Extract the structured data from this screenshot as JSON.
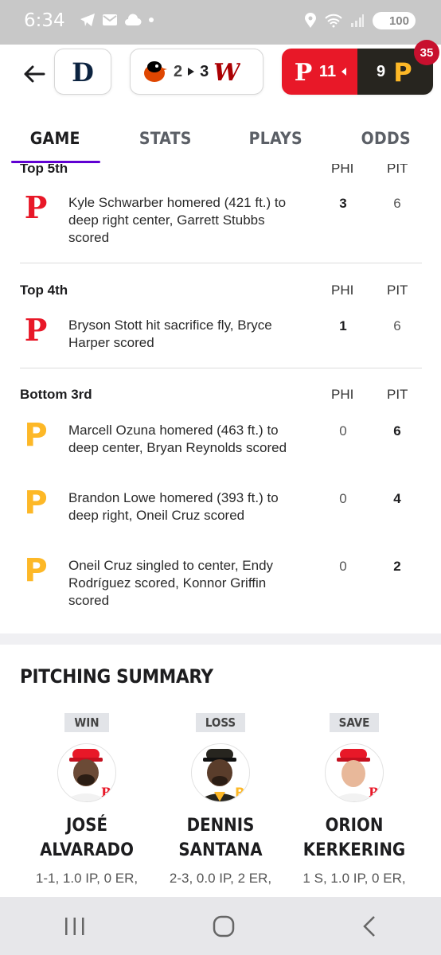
{
  "status_bar": {
    "time": "6:34",
    "battery": "100"
  },
  "scores": {
    "game1": {
      "team": "DET"
    },
    "game2": {
      "away": "BAL",
      "away_score": "2",
      "home_score": "3",
      "home": "WSH"
    },
    "game3": {
      "away": "PHI",
      "away_score": "11",
      "home_score": "9",
      "home": "PIT",
      "badge": "35"
    }
  },
  "tabs": [
    "GAME",
    "STATS",
    "PLAYS",
    "ODDS"
  ],
  "plays": [
    {
      "inning": "Top 5th",
      "cols": [
        "PHI",
        "PIT"
      ],
      "items": [
        {
          "team": "PHI",
          "text": "Kyle Schwarber homered (421 ft.) to deep right center, Garrett Stubbs scored",
          "phi": "3",
          "pit": "6",
          "bold": "phi"
        }
      ]
    },
    {
      "inning": "Top 4th",
      "cols": [
        "PHI",
        "PIT"
      ],
      "items": [
        {
          "team": "PHI",
          "text": "Bryson Stott hit sacrifice fly, Bryce Harper scored",
          "phi": "1",
          "pit": "6",
          "bold": "phi"
        }
      ]
    },
    {
      "inning": "Bottom 3rd",
      "cols": [
        "PHI",
        "PIT"
      ],
      "items": [
        {
          "team": "PIT",
          "text": "Marcell Ozuna homered (463 ft.) to deep center, Bryan Reynolds scored",
          "phi": "0",
          "pit": "6",
          "bold": "pit"
        },
        {
          "team": "PIT",
          "text": "Brandon Lowe homered (393 ft.) to deep right, Oneil Cruz scored",
          "phi": "0",
          "pit": "4",
          "bold": "pit"
        },
        {
          "team": "PIT",
          "text": "Oneil Cruz singled to center, Endy Rodríguez scored, Konnor Griffin scored",
          "phi": "0",
          "pit": "2",
          "bold": "pit"
        }
      ]
    }
  ],
  "pitching_summary": {
    "title": "PITCHING SUMMARY",
    "pitchers": [
      {
        "result": "WIN",
        "first": "JOSÉ",
        "last": "ALVARADO",
        "team": "PHI",
        "stats": "1-1, 1.0 IP, 0 ER,"
      },
      {
        "result": "LOSS",
        "first": "DENNIS",
        "last": "SANTANA",
        "team": "PIT",
        "stats": "2-3, 0.0 IP, 2 ER,"
      },
      {
        "result": "SAVE",
        "first": "ORION",
        "last": "KERKERING",
        "team": "PHI",
        "stats": "1 S, 1.0 IP, 0 ER,"
      }
    ]
  },
  "colors": {
    "phillies_red": "#e81828",
    "pirates_black": "#27251f",
    "pirates_gold": "#fdb827",
    "accent_purple": "#6001d2"
  }
}
